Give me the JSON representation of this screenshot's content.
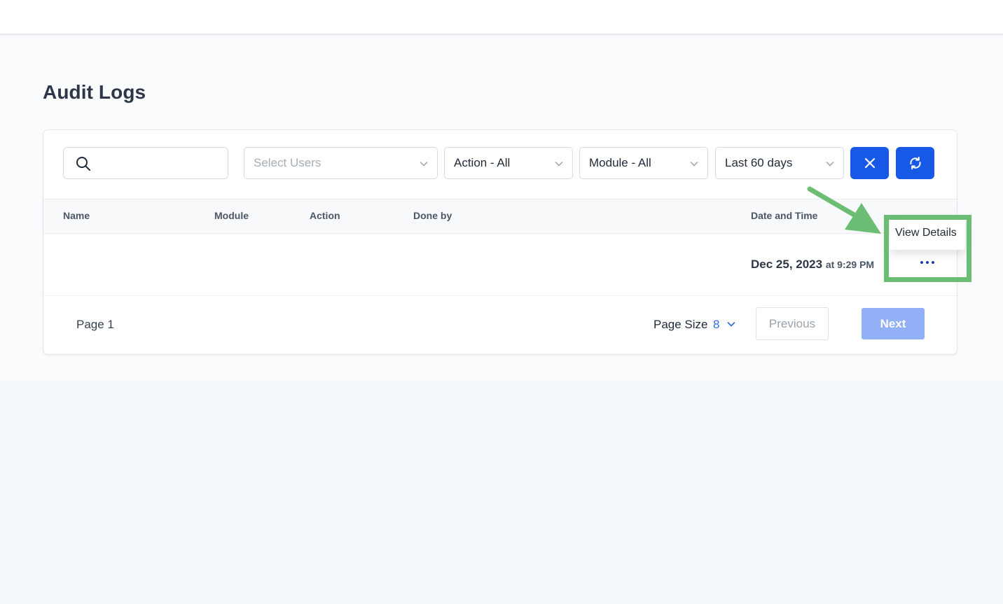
{
  "page": {
    "title": "Audit Logs"
  },
  "filters": {
    "search_placeholder": "",
    "users_placeholder": "Select Users",
    "action_value": "Action - All",
    "module_value": "Module - All",
    "date_value": "Last 60 days"
  },
  "table": {
    "headers": [
      "Name",
      "Module",
      "Action",
      "Done by",
      "Date and Time"
    ],
    "rows": [
      {
        "name": "",
        "module": "",
        "action": "",
        "done_by": "",
        "date": "Dec 25, 2023",
        "time": "at 9:29 PM"
      }
    ]
  },
  "row_menu": {
    "view_details": "View Details"
  },
  "pagination": {
    "page_label": "Page 1",
    "page_size_label": "Page Size",
    "page_size_value": "8",
    "previous_label": "Previous",
    "next_label": "Next"
  },
  "colors": {
    "primary": "#1858e6",
    "next_disabled": "#92b0f6",
    "annotation": "#6cbd74"
  },
  "icons": [
    "search-icon",
    "chevron-down-icon",
    "close-icon",
    "refresh-icon",
    "more-horizontal-icon",
    "arrow-icon"
  ]
}
